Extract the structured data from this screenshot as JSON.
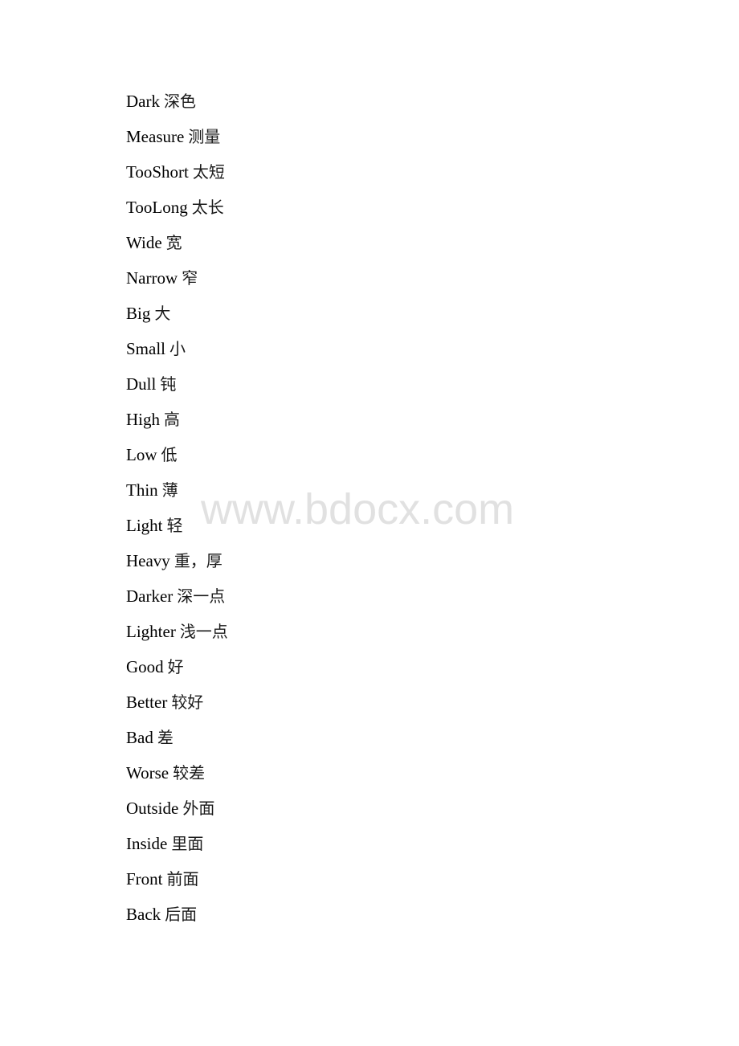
{
  "document": {
    "entries": [
      {
        "en": "Dark",
        "zh": "深色"
      },
      {
        "en": "Measure",
        "zh": "测量"
      },
      {
        "en": "TooShort",
        "zh": "太短"
      },
      {
        "en": "TooLong",
        "zh": "太长"
      },
      {
        "en": "Wide",
        "zh": "宽"
      },
      {
        "en": "Narrow",
        "zh": "窄"
      },
      {
        "en": "Big",
        "zh": "大"
      },
      {
        "en": "Small",
        "zh": "小"
      },
      {
        "en": "Dull",
        "zh": "钝"
      },
      {
        "en": "High",
        "zh": "高"
      },
      {
        "en": "Low",
        "zh": "低"
      },
      {
        "en": "Thin",
        "zh": "薄"
      },
      {
        "en": "Light",
        "zh": "轻"
      },
      {
        "en": "Heavy",
        "zh": "重，厚"
      },
      {
        "en": "Darker",
        "zh": "深一点"
      },
      {
        "en": "Lighter",
        "zh": "浅一点"
      },
      {
        "en": "Good",
        "zh": "好"
      },
      {
        "en": "Better",
        "zh": "较好"
      },
      {
        "en": "Bad",
        "zh": "差"
      },
      {
        "en": "Worse",
        "zh": "较差"
      },
      {
        "en": "Outside",
        "zh": "外面"
      },
      {
        "en": "Inside",
        "zh": "里面"
      },
      {
        "en": "Front",
        "zh": "前面"
      },
      {
        "en": "Back",
        "zh": "后面"
      }
    ]
  },
  "watermark": {
    "text": "www.bdocx.com",
    "color": "#e1e1e1"
  }
}
